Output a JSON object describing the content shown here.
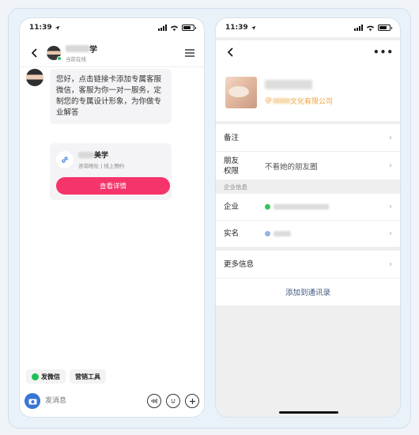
{
  "left": {
    "status_time": "11:39",
    "chat_title_visible": "学",
    "online_status": "当前在线",
    "message": "您好，点击链接卡添加专属客服微信，客服为你一对一服务，定制您的专属设计形象，为你做专业解答",
    "card": {
      "title_visible": "美学",
      "subtitle": "咨询地址 | 线上预约",
      "button": "查看详情"
    },
    "chips": [
      "发微信",
      "营销工具"
    ],
    "input_placeholder": "发消息"
  },
  "right": {
    "status_time": "11:39",
    "company_visible": "文化有限公司",
    "rows": {
      "remark": "备注",
      "friend_perm_label": "朋友\n权限",
      "friend_perm_value": "不看她的朋友圈",
      "enterprise_section": "企业信息",
      "enterprise": "企业",
      "real_name": "实名",
      "more_info": "更多信息",
      "add_contact": "添加到通讯录"
    }
  },
  "colors": {
    "accent_pink": "#f5346b",
    "company_orange": "#f2a13a",
    "link_blue": "#40577d",
    "camera_blue": "#3a75d6",
    "wechat_green": "#1fbf57"
  },
  "icons": [
    "back-icon",
    "menu-icon",
    "link-icon",
    "camera-icon",
    "voice-icon",
    "emoji-icon",
    "plus-icon",
    "more-icon",
    "chevron-right-icon"
  ]
}
